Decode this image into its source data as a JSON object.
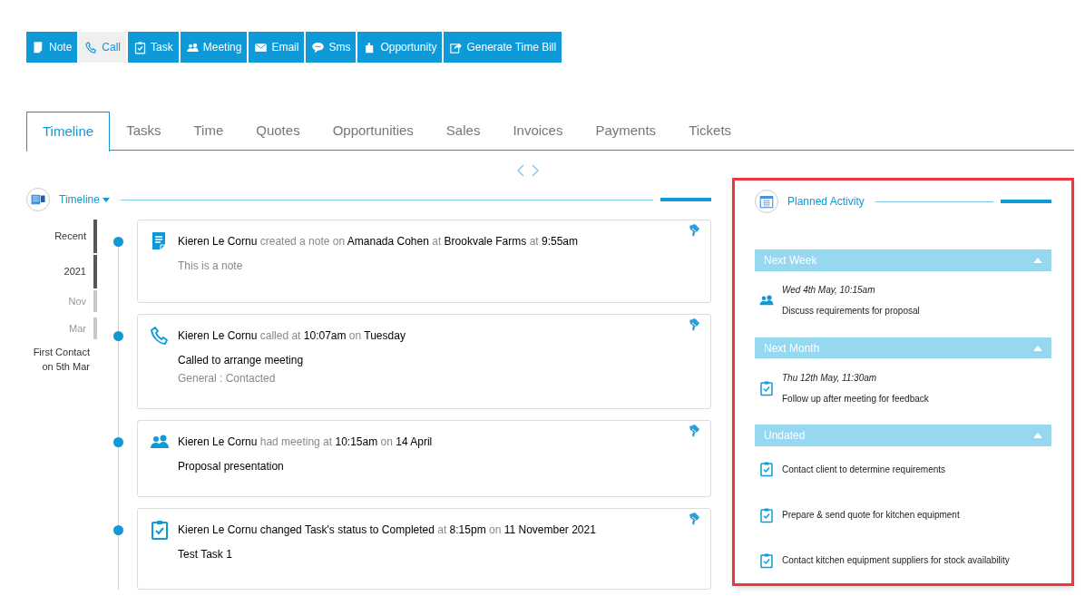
{
  "toolbar": [
    {
      "kind": "note",
      "label": "Note",
      "selected": false
    },
    {
      "kind": "call",
      "label": "Call",
      "selected": true
    },
    {
      "kind": "task",
      "label": "Task",
      "selected": false
    },
    {
      "kind": "meeting",
      "label": "Meeting",
      "selected": false
    },
    {
      "kind": "email",
      "label": "Email",
      "selected": false
    },
    {
      "kind": "sms",
      "label": "Sms",
      "selected": false
    },
    {
      "kind": "opportunity",
      "label": "Opportunity",
      "selected": false
    },
    {
      "kind": "bill",
      "label": "Generate Time Bill",
      "selected": false
    }
  ],
  "tabs": [
    {
      "label": "Timeline",
      "selected": true
    },
    {
      "label": "Tasks",
      "selected": false
    },
    {
      "label": "Time",
      "selected": false
    },
    {
      "label": "Quotes",
      "selected": false
    },
    {
      "label": "Opportunities",
      "selected": false
    },
    {
      "label": "Sales",
      "selected": false
    },
    {
      "label": "Invoices",
      "selected": false
    },
    {
      "label": "Payments",
      "selected": false
    },
    {
      "label": "Tickets",
      "selected": false
    }
  ],
  "timeline": {
    "title": "Timeline",
    "nav": [
      {
        "label": "Recent",
        "current": true
      },
      {
        "label": "2021",
        "current": true
      },
      {
        "label": "Nov",
        "current": false
      },
      {
        "label": "Mar",
        "current": false
      }
    ],
    "first_contact": "First Contact on 5th Mar",
    "entries": [
      {
        "kind": "note",
        "headline": [
          {
            "text": "Kieren Le Cornu",
            "muted": false
          },
          {
            "text": "created a note on",
            "muted": true
          },
          {
            "text": "Amanada Cohen",
            "muted": false
          },
          {
            "text": "at",
            "muted": true
          },
          {
            "text": "Brookvale Farms",
            "muted": false
          },
          {
            "text": "at",
            "muted": true
          },
          {
            "text": "9:55am",
            "muted": false
          }
        ],
        "body": [
          {
            "text": "This is a note",
            "muted": true
          }
        ]
      },
      {
        "kind": "call",
        "headline": [
          {
            "text": "Kieren Le Cornu",
            "muted": false
          },
          {
            "text": "called at",
            "muted": true
          },
          {
            "text": "10:07am",
            "muted": false
          },
          {
            "text": "on",
            "muted": true
          },
          {
            "text": "Tuesday",
            "muted": false
          }
        ],
        "body": [
          {
            "text": "Called to arrange meeting",
            "muted": false
          },
          {
            "text": "General : Contacted",
            "muted": true
          }
        ]
      },
      {
        "kind": "meeting",
        "headline": [
          {
            "text": "Kieren Le Cornu",
            "muted": false
          },
          {
            "text": "had meeting at",
            "muted": true
          },
          {
            "text": "10:15am",
            "muted": false
          },
          {
            "text": "on",
            "muted": true
          },
          {
            "text": "14 April",
            "muted": false
          }
        ],
        "body": [
          {
            "text": "Proposal presentation",
            "muted": false
          }
        ]
      },
      {
        "kind": "task",
        "headline": [
          {
            "text": "Kieren Le Cornu changed Task's status to Completed",
            "muted": false
          },
          {
            "text": "at",
            "muted": true
          },
          {
            "text": "8:15pm",
            "muted": false
          },
          {
            "text": "on",
            "muted": true
          },
          {
            "text": "11 November 2021",
            "muted": false
          }
        ],
        "body": [
          {
            "text": "Test Task 1",
            "muted": false
          }
        ]
      }
    ]
  },
  "planned": {
    "title": "Planned Activity",
    "groups": [
      {
        "title": "Next Week",
        "expanded": true,
        "items": [
          {
            "kind": "meeting",
            "date": "Wed 4th May, 10:15am",
            "text": "Discuss requirements for proposal"
          }
        ]
      },
      {
        "title": "Next Month",
        "expanded": true,
        "items": [
          {
            "kind": "task",
            "date": "Thu 12th May, 11:30am",
            "text": "Follow up after meeting for feedback"
          }
        ]
      },
      {
        "title": "Undated",
        "expanded": true,
        "items": [
          {
            "kind": "task",
            "text": "Contact client to determine requirements"
          },
          {
            "kind": "task",
            "text": "Prepare & send quote for kitchen equipment"
          },
          {
            "kind": "task",
            "text": "Contact kitchen equipment suppliers for stock availability"
          }
        ]
      }
    ]
  }
}
